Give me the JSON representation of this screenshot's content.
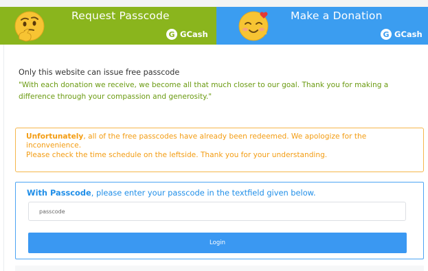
{
  "banners": {
    "request": {
      "title": "Request Passcode",
      "brand": "GCash",
      "brand_icon_letter": "G",
      "color": "#8ab51d",
      "emoji": "thinking-face-icon"
    },
    "donate": {
      "title": "Make a Donation",
      "brand": "GCash",
      "brand_icon_letter": "G",
      "color": "#3b9df0",
      "emoji": "smiling-face-with-hearts-icon"
    }
  },
  "notice": "Only this website can issue free passcode",
  "quote": "\"With each donation we receive, we become all that much closer to our goal. Thank you for making a difference through your compassion and generosity.\"",
  "warning": {
    "lead": "Unfortunately",
    "text1": ", all of the free passcodes have already been redeemed. We apologize for the inconvenience.",
    "text2": "Please check the time schedule on the leftside. Thank you for your understanding.",
    "color": "#f39c12"
  },
  "form": {
    "label_bold": "With Passcode",
    "label_rest": ", please enter your passcode in the textfield given below.",
    "placeholder": "passcode",
    "value": "",
    "login_label": "Login",
    "accent": "#3a98f2"
  }
}
